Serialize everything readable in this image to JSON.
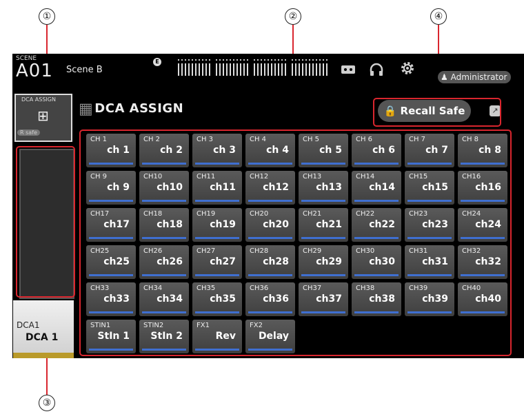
{
  "callouts": [
    "①",
    "②",
    "③",
    "④"
  ],
  "scene": {
    "label": "SCENE",
    "number": "A01",
    "name": "Scene B",
    "edit_badge": "E"
  },
  "top_icons": {
    "recorder": "cassette-icon",
    "headphones": "headphones-icon",
    "settings": "gear-icon"
  },
  "user": {
    "role": "Administrator",
    "icon": "person-icon"
  },
  "sidebar": {
    "button_label": "DCA ASSIGN",
    "button_icon": "grid-icon",
    "rsafe_label": "R safe"
  },
  "dca": {
    "label": "DCA1",
    "name": "DCA 1"
  },
  "page": {
    "title": "DCA ASSIGN",
    "title_icon": "grid-icon"
  },
  "recall_safe": {
    "label": "Recall Safe",
    "icon": "lock-icon",
    "popup_icon": "external-link-icon"
  },
  "colors": {
    "accent_blue": "#3f6fd0",
    "highlight_red": "#d9262e",
    "dca_gold": "#b99a2a"
  },
  "channels": [
    {
      "id": "CH 1",
      "name": "ch 1"
    },
    {
      "id": "CH 2",
      "name": "ch 2"
    },
    {
      "id": "CH 3",
      "name": "ch 3"
    },
    {
      "id": "CH 4",
      "name": "ch 4"
    },
    {
      "id": "CH 5",
      "name": "ch 5"
    },
    {
      "id": "CH 6",
      "name": "ch 6"
    },
    {
      "id": "CH 7",
      "name": "ch 7"
    },
    {
      "id": "CH 8",
      "name": "ch 8"
    },
    {
      "id": "CH 9",
      "name": "ch 9"
    },
    {
      "id": "CH10",
      "name": "ch10"
    },
    {
      "id": "CH11",
      "name": "ch11"
    },
    {
      "id": "CH12",
      "name": "ch12"
    },
    {
      "id": "CH13",
      "name": "ch13"
    },
    {
      "id": "CH14",
      "name": "ch14"
    },
    {
      "id": "CH15",
      "name": "ch15"
    },
    {
      "id": "CH16",
      "name": "ch16"
    },
    {
      "id": "CH17",
      "name": "ch17"
    },
    {
      "id": "CH18",
      "name": "ch18"
    },
    {
      "id": "CH19",
      "name": "ch19"
    },
    {
      "id": "CH20",
      "name": "ch20"
    },
    {
      "id": "CH21",
      "name": "ch21"
    },
    {
      "id": "CH22",
      "name": "ch22"
    },
    {
      "id": "CH23",
      "name": "ch23"
    },
    {
      "id": "CH24",
      "name": "ch24"
    },
    {
      "id": "CH25",
      "name": "ch25"
    },
    {
      "id": "CH26",
      "name": "ch26"
    },
    {
      "id": "CH27",
      "name": "ch27"
    },
    {
      "id": "CH28",
      "name": "ch28"
    },
    {
      "id": "CH29",
      "name": "ch29"
    },
    {
      "id": "CH30",
      "name": "ch30"
    },
    {
      "id": "CH31",
      "name": "ch31"
    },
    {
      "id": "CH32",
      "name": "ch32"
    },
    {
      "id": "CH33",
      "name": "ch33"
    },
    {
      "id": "CH34",
      "name": "ch34"
    },
    {
      "id": "CH35",
      "name": "ch35"
    },
    {
      "id": "CH36",
      "name": "ch36"
    },
    {
      "id": "CH37",
      "name": "ch37"
    },
    {
      "id": "CH38",
      "name": "ch38"
    },
    {
      "id": "CH39",
      "name": "ch39"
    },
    {
      "id": "CH40",
      "name": "ch40"
    },
    {
      "id": "STIN1",
      "name": "StIn 1"
    },
    {
      "id": "STIN2",
      "name": "StIn 2"
    },
    {
      "id": "FX1",
      "name": "Rev"
    },
    {
      "id": "FX2",
      "name": "Delay"
    }
  ]
}
